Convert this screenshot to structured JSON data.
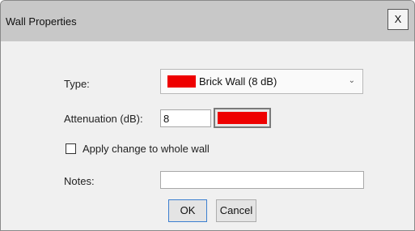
{
  "window": {
    "title": "Wall Properties",
    "close_label": "X"
  },
  "form": {
    "type_label": "Type:",
    "type_value": "Brick Wall (8 dB)",
    "type_swatch_color": "#ee0000",
    "attenuation_label": "Attenuation (dB):",
    "attenuation_value": "8",
    "color_value": "#ee0000",
    "apply_whole_wall_label": "Apply change to whole wall",
    "apply_whole_wall_checked": false,
    "notes_label": "Notes:",
    "notes_value": ""
  },
  "buttons": {
    "ok_label": "OK",
    "cancel_label": "Cancel"
  }
}
